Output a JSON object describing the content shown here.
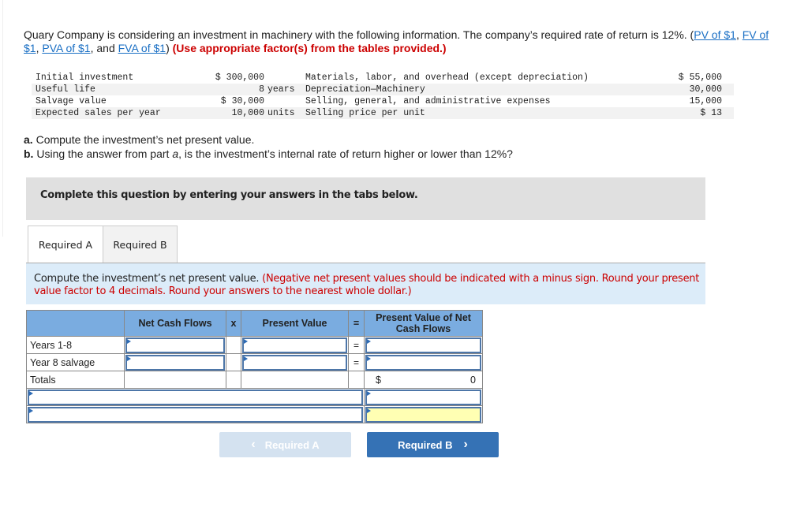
{
  "intro": {
    "text_before": "Quary Company is considering an investment in machinery with the following information. The company’s required rate of return is 12%. (",
    "links": [
      "PV of $1",
      "FV of $1",
      "PVA of $1",
      "FVA of $1"
    ],
    "sep1": ", ",
    "sep2": ", ",
    "sep3": ", and ",
    "text_after": ") ",
    "red_note": "(Use appropriate factor(s) from the tables provided.)"
  },
  "given": [
    {
      "label": "Initial investment",
      "value": "$ 300,000",
      "unit": "",
      "label2": "Materials, labor, and overhead (except depreciation)",
      "value2": "$ 55,000"
    },
    {
      "label": "Useful life",
      "value": "8",
      "unit": "years",
      "label2": "Depreciation—Machinery",
      "value2": "30,000"
    },
    {
      "label": "Salvage value",
      "value": "$ 30,000",
      "unit": "",
      "label2": "Selling, general, and administrative expenses",
      "value2": "15,000"
    },
    {
      "label": "Expected sales per year",
      "value": "10,000",
      "unit": "units",
      "label2": "Selling price per unit",
      "value2": "$ 13"
    }
  ],
  "questions": {
    "a_label": "a.",
    "a_text": " Compute the investment’s net present value.",
    "b_label": "b.",
    "b_text_1": " Using the answer from part ",
    "b_italic": "a",
    "b_text_2": ", is the investment’s internal rate of return higher or lower than 12%?"
  },
  "instructions": "Complete this question by entering your answers in the tabs below.",
  "tabs": [
    {
      "label": "Required A",
      "active": true
    },
    {
      "label": "Required B",
      "active": false
    }
  ],
  "prompt": {
    "text": "Compute the investment’s net present value. ",
    "red": "(Negative net present values should be indicated with a minus sign. Round your present value factor to 4 decimals. Round your answers to the nearest whole dollar.)"
  },
  "table": {
    "headers": [
      "",
      "Net Cash Flows",
      "x",
      "Present Value",
      "=",
      "Present Value of Net Cash Flows"
    ],
    "rows": [
      {
        "label": "Years 1-8",
        "ncf": "",
        "pv": "",
        "eq": "=",
        "pvncf": ""
      },
      {
        "label": "Year 8 salvage",
        "ncf": "",
        "pv": "",
        "eq": "=",
        "pvncf": ""
      }
    ],
    "totals": {
      "label": "Totals",
      "currency": "$",
      "value": "0"
    },
    "extra_rows": [
      {
        "label_value": "",
        "amount_value": ""
      },
      {
        "label_value": "",
        "amount_value": ""
      }
    ]
  },
  "nav": {
    "prev_label": "Required A",
    "next_label": "Required B",
    "prev_icon": "‹",
    "next_icon": "›"
  },
  "colors": {
    "header_blue": "#7aace0",
    "prompt_bg": "#dcecf9",
    "note_red": "#cc0000",
    "next_button": "#3572b5",
    "prev_button_disabled": "#d4e2f0",
    "highlight_yellow": "#ffffb3"
  }
}
